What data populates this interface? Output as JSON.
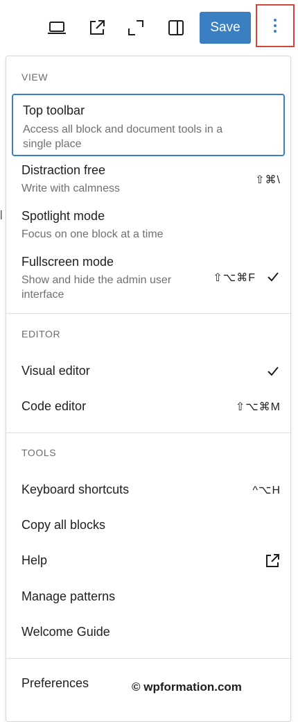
{
  "toolbar": {
    "icons": [
      "desktop-preview-icon",
      "view-external-icon",
      "fullscreen-icon",
      "sidebar-toggle-icon"
    ],
    "save_label": "Save",
    "more_icon": "vertical-ellipsis-icon",
    "highlight_color": "#d6453a",
    "save_color": "#3a7fc1"
  },
  "menu": {
    "view": {
      "title": "VIEW",
      "items": [
        {
          "label": "Top toolbar",
          "desc": "Access all block and document tools in a single place",
          "shortcut": "",
          "checked": false,
          "selected": true
        },
        {
          "label": "Distraction free",
          "desc": "Write with calmness",
          "shortcut": "⇧⌘\\",
          "checked": false
        },
        {
          "label": "Spotlight mode",
          "desc": "Focus on one block at a time",
          "shortcut": "",
          "checked": false
        },
        {
          "label": "Fullscreen mode",
          "desc": "Show and hide the admin user interface",
          "shortcut": "⇧⌥⌘F",
          "checked": true
        }
      ]
    },
    "editor": {
      "title": "EDITOR",
      "items": [
        {
          "label": "Visual editor",
          "shortcut": "",
          "checked": true
        },
        {
          "label": "Code editor",
          "shortcut": "⇧⌥⌘M",
          "checked": false
        }
      ]
    },
    "tools": {
      "title": "TOOLS",
      "items": [
        {
          "label": "Keyboard shortcuts",
          "shortcut": "^⌥H"
        },
        {
          "label": "Copy all blocks",
          "shortcut": ""
        },
        {
          "label": "Help",
          "shortcut": "",
          "icon": "external-link-icon"
        },
        {
          "label": "Manage patterns",
          "shortcut": ""
        },
        {
          "label": "Welcome Guide",
          "shortcut": ""
        }
      ]
    },
    "footer": {
      "items": [
        {
          "label": "Preferences"
        }
      ]
    }
  },
  "watermark": "© wpformation.com"
}
